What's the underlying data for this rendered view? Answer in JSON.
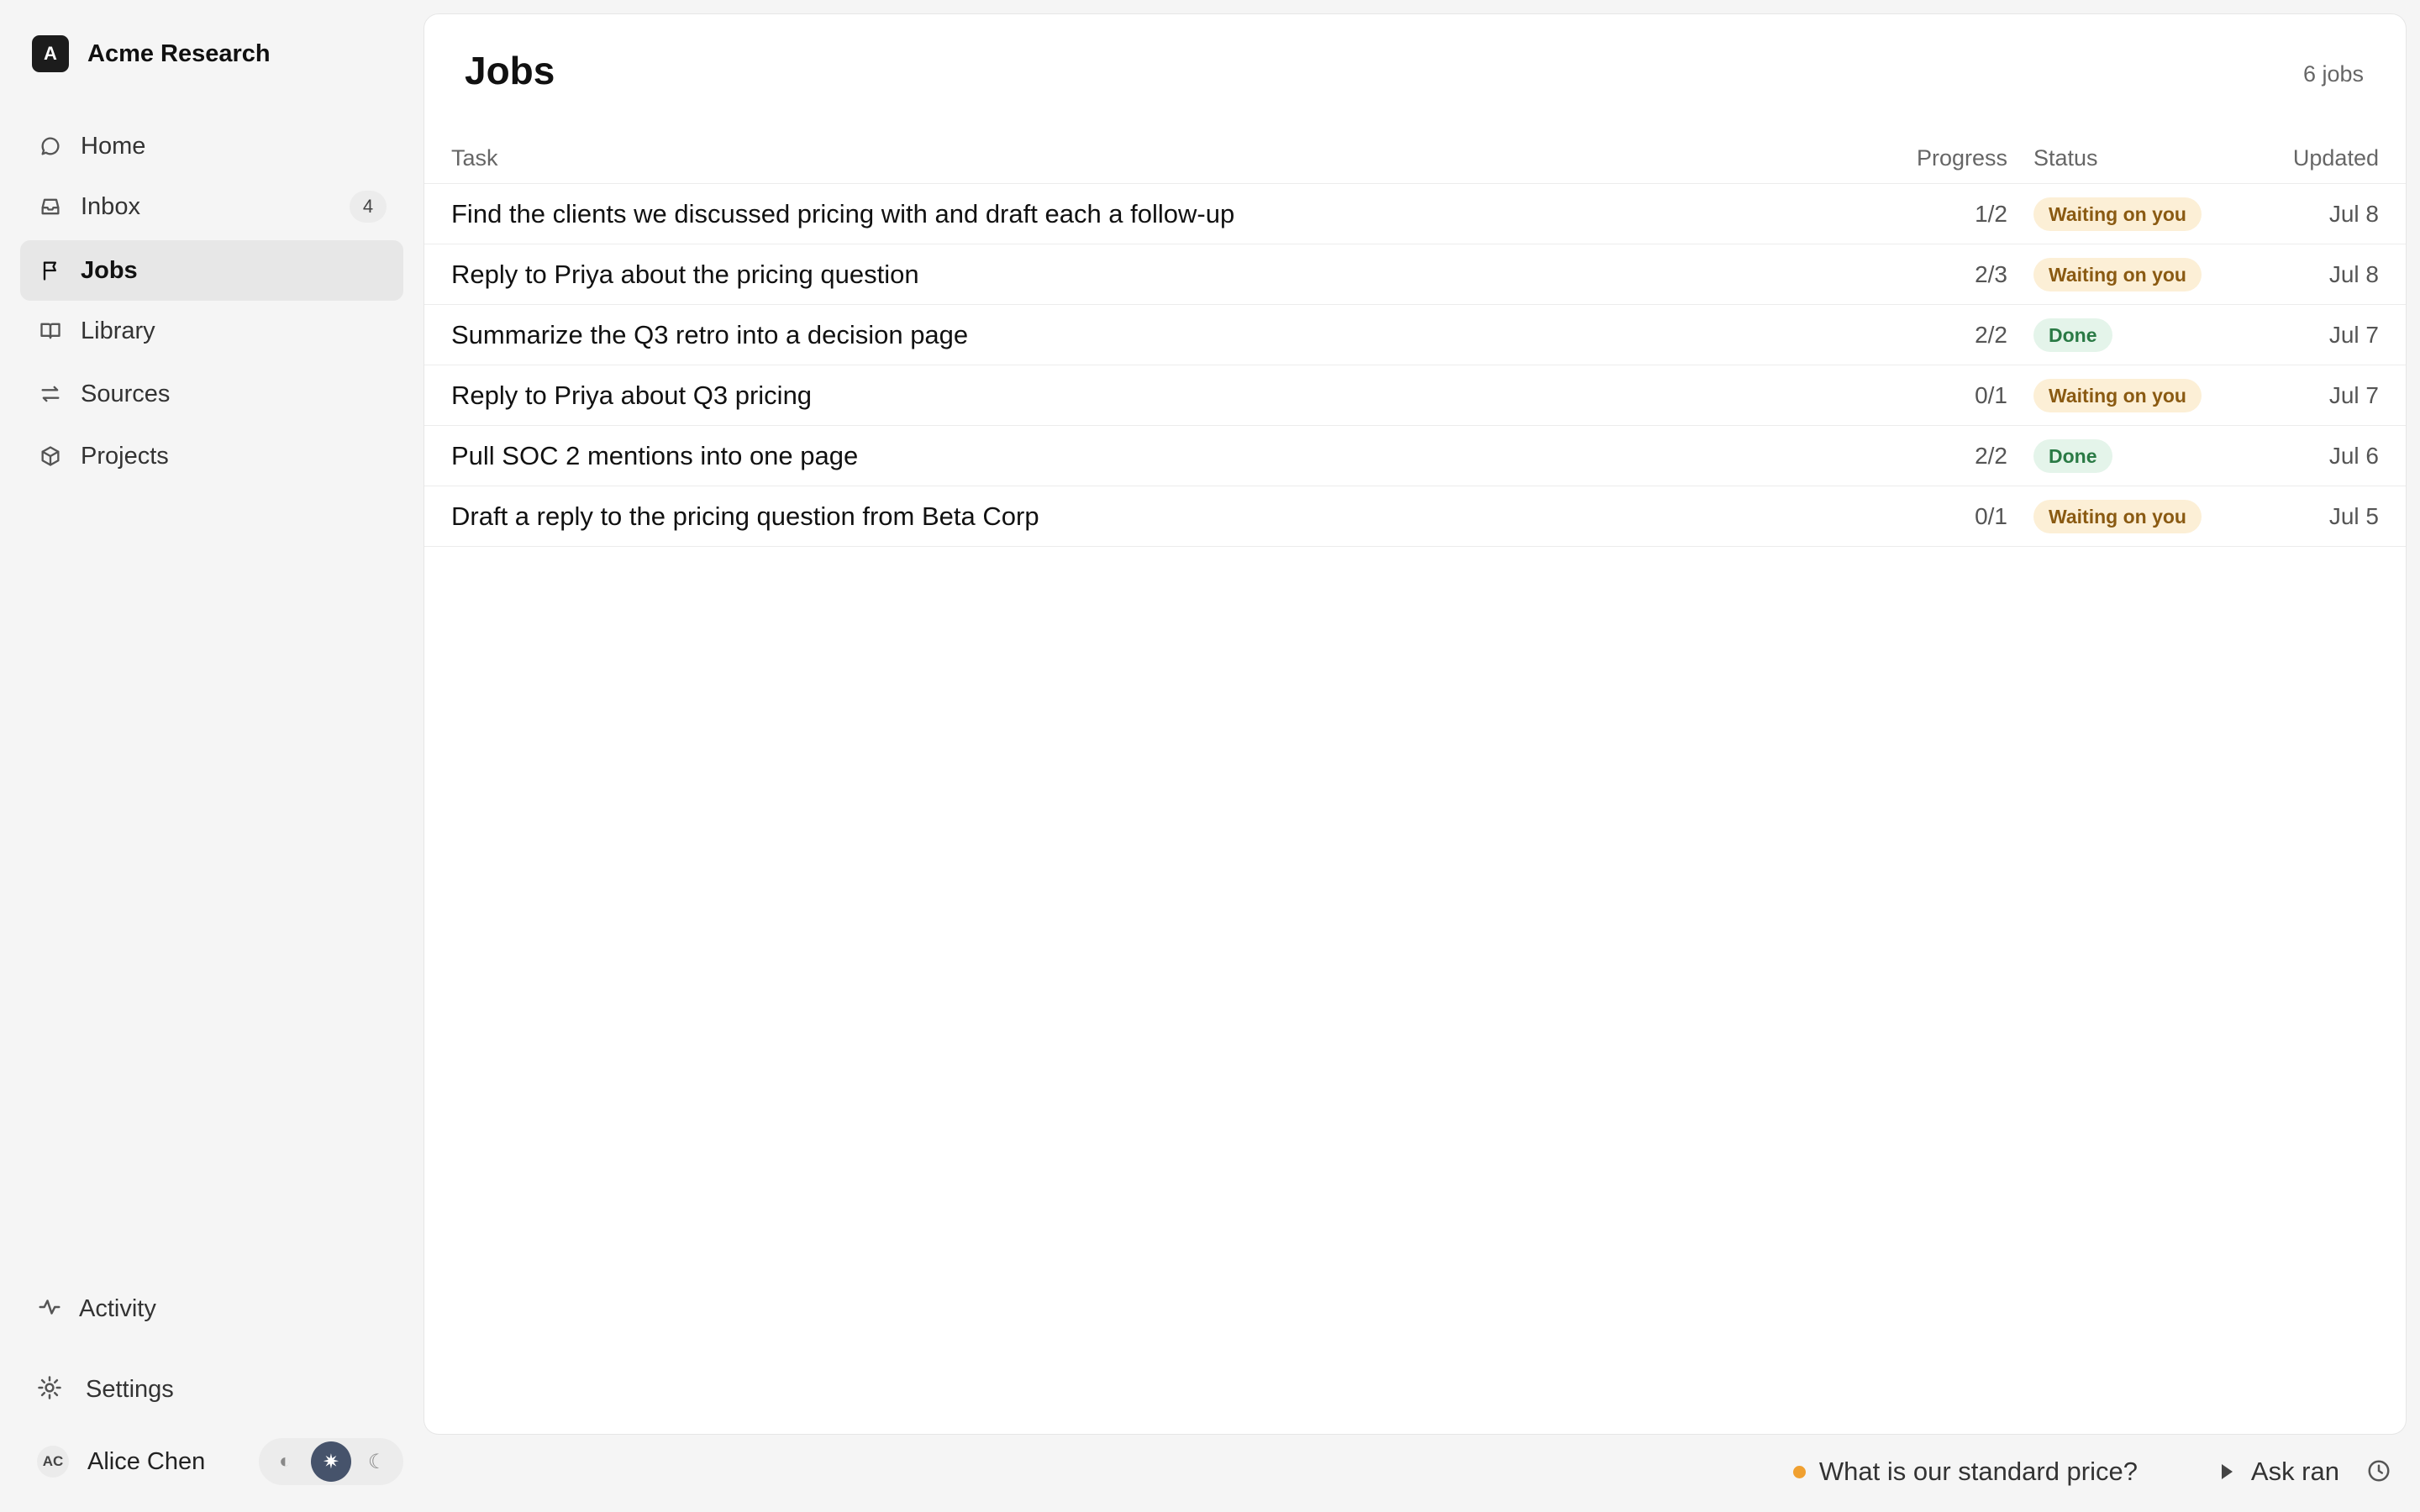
{
  "brand": {
    "logo_letter": "A",
    "name": "Acme Research"
  },
  "sidebar": {
    "items": [
      {
        "label": "Home",
        "icon": "chat-bubble-icon"
      },
      {
        "label": "Inbox",
        "icon": "inbox-icon",
        "badge": "4"
      },
      {
        "label": "Jobs",
        "icon": "flag-icon",
        "active": true
      },
      {
        "label": "Library",
        "icon": "book-icon"
      },
      {
        "label": "Sources",
        "icon": "arrows-exchange-icon"
      },
      {
        "label": "Projects",
        "icon": "cube-icon"
      }
    ],
    "activity_label": "Activity",
    "settings_label": "Settings",
    "user": {
      "initials": "AC",
      "name": "Alice Chen"
    },
    "theme": {
      "options": [
        "contrast",
        "light",
        "dark"
      ],
      "selected": "light"
    }
  },
  "main": {
    "title": "Jobs",
    "count": "6 jobs",
    "columns": {
      "task": "Task",
      "progress": "Progress",
      "status": "Status",
      "updated": "Updated"
    },
    "rows": [
      {
        "task": "Find the clients we discussed pricing with and draft each a follow-up",
        "progress": "1/2",
        "status": "Waiting on you",
        "updated": "Jul 8"
      },
      {
        "task": "Reply to Priya about the pricing question",
        "progress": "2/3",
        "status": "Waiting on you",
        "updated": "Jul 8"
      },
      {
        "task": "Summarize the Q3 retro into a decision page",
        "progress": "2/2",
        "status": "Done",
        "updated": "Jul 7"
      },
      {
        "task": "Reply to Priya about Q3 pricing",
        "progress": "0/1",
        "status": "Waiting on you",
        "updated": "Jul 7"
      },
      {
        "task": "Pull SOC 2 mentions into one page",
        "progress": "2/2",
        "status": "Done",
        "updated": "Jul 6"
      },
      {
        "task": "Draft a reply to the pricing question from Beta Corp",
        "progress": "0/1",
        "status": "Waiting on you",
        "updated": "Jul 5"
      }
    ]
  },
  "footer": {
    "query": "What is our standard price?",
    "ask_label": "Ask ran"
  },
  "colors": {
    "waiting_bg": "#fcefd6",
    "waiting_text": "#8a5a12",
    "done_bg": "#e4f4ea",
    "done_text": "#2a7a45",
    "theme_selected": "#46536b",
    "status_dot": "#f0a030"
  }
}
